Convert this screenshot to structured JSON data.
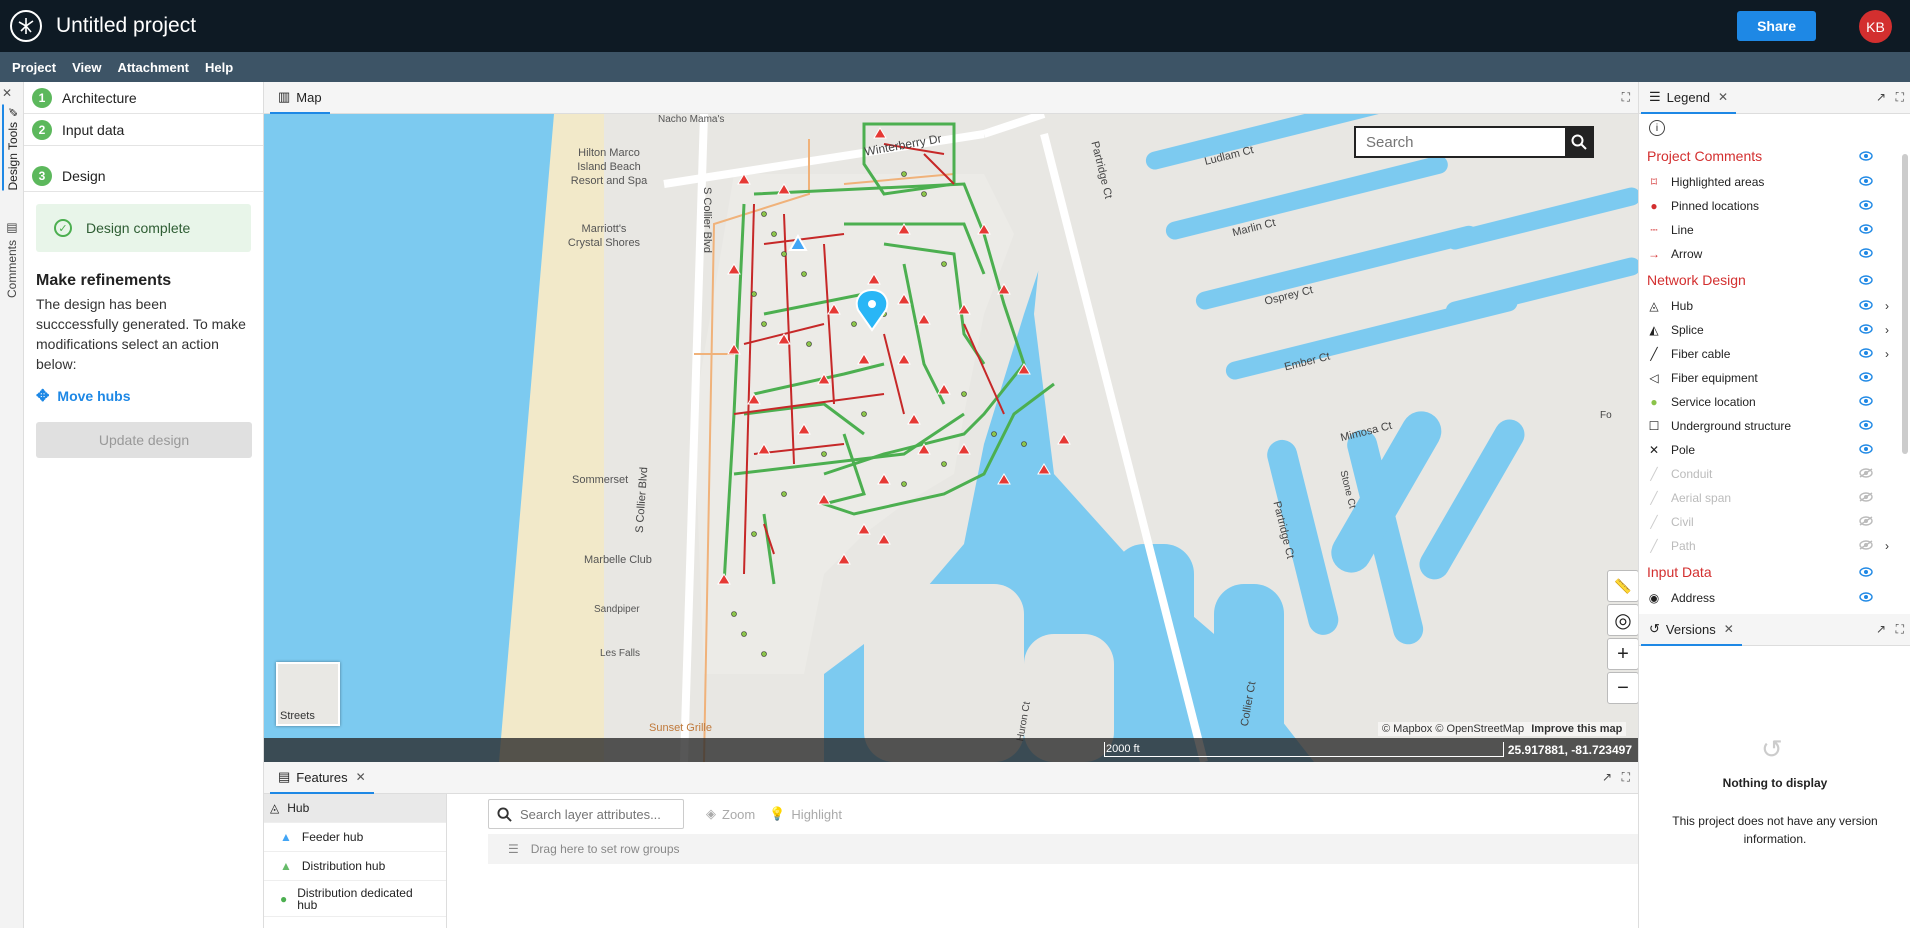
{
  "app": {
    "title": "Untitled project",
    "share_label": "Share",
    "avatar_initials": "KB"
  },
  "menu": [
    "Project",
    "View",
    "Attachment",
    "Help"
  ],
  "side_tabs": {
    "design_tools": "Design Tools",
    "comments": "Comments"
  },
  "steps": [
    {
      "num": "1",
      "label": "Architecture"
    },
    {
      "num": "2",
      "label": "Input data"
    },
    {
      "num": "3",
      "label": "Design"
    }
  ],
  "design": {
    "complete_label": "Design complete",
    "refine_title": "Make refinements",
    "refine_text": "The design has been succcessfully generated. To make modifications select an action below:",
    "move_hubs_label": "Move hubs",
    "update_label": "Update design"
  },
  "map": {
    "tab_label": "Map",
    "search_placeholder": "Search",
    "streets_label": "Streets",
    "attribution": "© Mapbox © OpenStreetMap",
    "improve_label": "Improve this map",
    "scale_label": "2000 ft",
    "coordinates": "25.917881, -81.723497",
    "place_labels": [
      "Nacho Mama's",
      "Hilton Marco Island Beach Resort and Spa",
      "Marriott's Crystal Shores",
      "Sommerset",
      "Marbelle Club",
      "Sandpiper",
      "Les Falls",
      "Sunset Grille"
    ],
    "street_labels": [
      "Winterberry Dr",
      "S Collier Blvd",
      "Partridge Ct",
      "Ludlam Ct",
      "Marlin Ct",
      "Osprey Ct",
      "Ember Ct",
      "Mimosa Ct",
      "Stone Ct",
      "Huron Ct",
      "Collier Ct",
      "Fo"
    ]
  },
  "features": {
    "tab_label": "Features",
    "items": [
      {
        "label": "Hub",
        "color": "#333333"
      },
      {
        "label": "Feeder hub",
        "color": "#42a5f5"
      },
      {
        "label": "Distribution hub",
        "color": "#66bb6a"
      },
      {
        "label": "Distribution dedicated hub",
        "color": "#4caf50"
      }
    ],
    "search_placeholder": "Search layer attributes...",
    "zoom_label": "Zoom",
    "highlight_label": "Highlight",
    "drag_hint": "Drag here to set row groups"
  },
  "legend": {
    "tab_label": "Legend",
    "sections": [
      {
        "title": "Project Comments",
        "rows": [
          {
            "label": "Highlighted areas",
            "icon": "highlight-icon",
            "enabled": true,
            "expand": false
          },
          {
            "label": "Pinned locations",
            "icon": "pin-icon",
            "enabled": true,
            "expand": false
          },
          {
            "label": "Line",
            "icon": "line-icon",
            "enabled": true,
            "expand": false
          },
          {
            "label": "Arrow",
            "icon": "arrow-icon",
            "enabled": true,
            "expand": false
          }
        ]
      },
      {
        "title": "Network Design",
        "rows": [
          {
            "label": "Hub",
            "icon": "hub-icon",
            "enabled": true,
            "expand": true
          },
          {
            "label": "Splice",
            "icon": "splice-icon",
            "enabled": true,
            "expand": true
          },
          {
            "label": "Fiber cable",
            "icon": "fiber-cable-icon",
            "enabled": true,
            "expand": true
          },
          {
            "label": "Fiber equipment",
            "icon": "fiber-equipment-icon",
            "enabled": true,
            "expand": false
          },
          {
            "label": "Service location",
            "icon": "service-location-icon",
            "enabled": true,
            "expand": false
          },
          {
            "label": "Underground structure",
            "icon": "underground-icon",
            "enabled": true,
            "expand": false
          },
          {
            "label": "Pole",
            "icon": "pole-icon",
            "enabled": true,
            "expand": false
          },
          {
            "label": "Conduit",
            "icon": "conduit-icon",
            "enabled": false,
            "expand": false
          },
          {
            "label": "Aerial span",
            "icon": "aerial-icon",
            "enabled": false,
            "expand": false
          },
          {
            "label": "Civil",
            "icon": "civil-icon",
            "enabled": false,
            "expand": false
          },
          {
            "label": "Path",
            "icon": "path-icon",
            "enabled": false,
            "expand": true
          }
        ]
      },
      {
        "title": "Input Data",
        "rows": [
          {
            "label": "Address",
            "icon": "address-icon",
            "enabled": true,
            "expand": false
          }
        ]
      }
    ]
  },
  "versions": {
    "tab_label": "Versions",
    "empty_title": "Nothing to display",
    "empty_text": "This project does not have any version information."
  },
  "colors": {
    "accent": "#1e88e5",
    "water": "#7ccaf0",
    "green_cable": "#4caf50",
    "red_cable": "#c62828",
    "legend_section": "#d32f2f"
  }
}
